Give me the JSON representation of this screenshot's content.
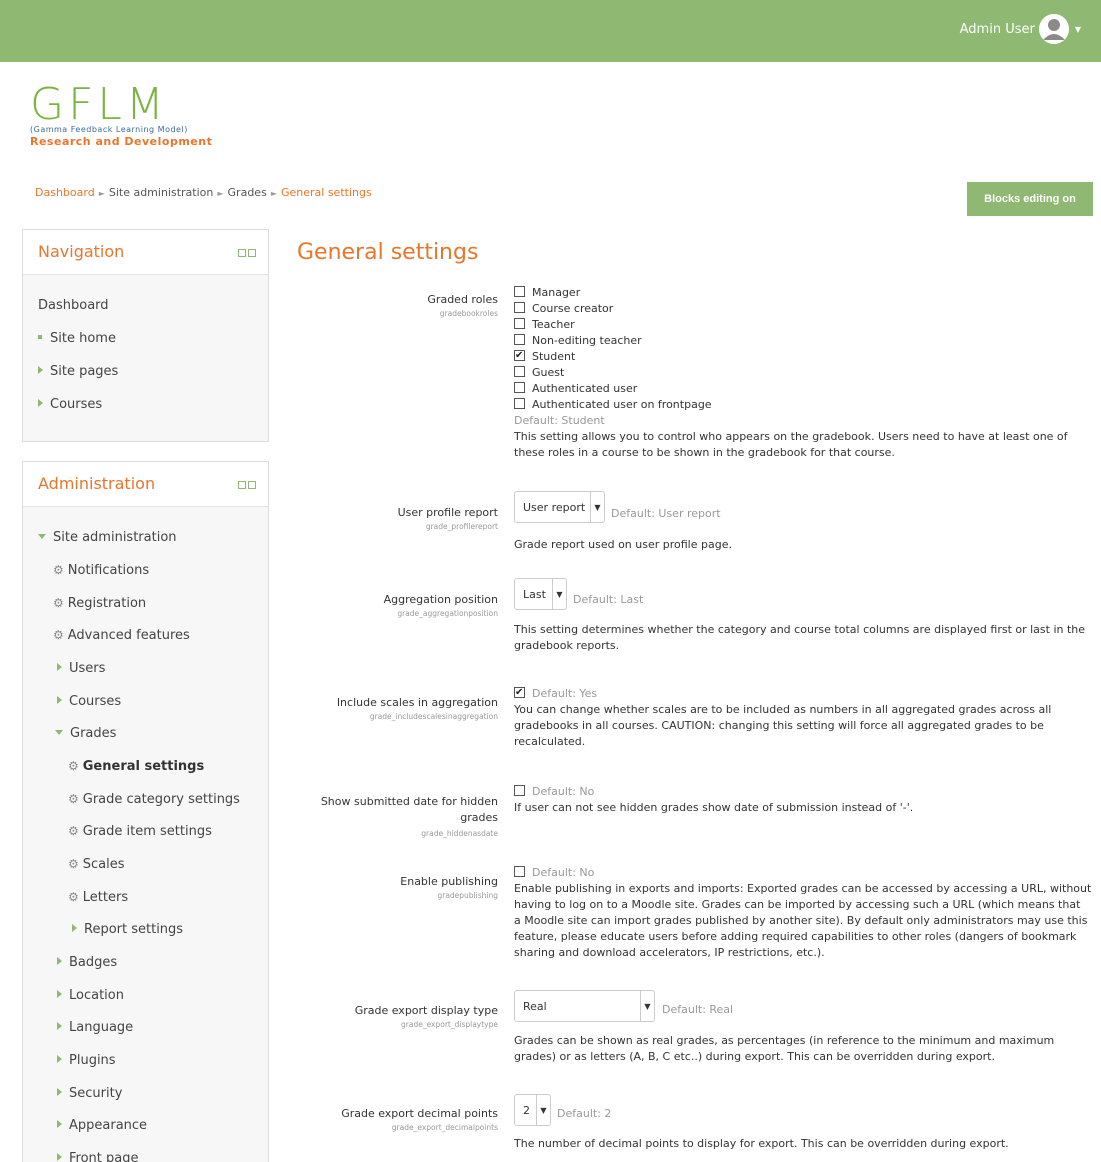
{
  "user": {
    "name": "Admin User"
  },
  "logo": {
    "main": "GFLM",
    "sub1": "(Gamma Feedback Learning Model)",
    "sub2": "Research and Development"
  },
  "breadcrumb": [
    "Dashboard",
    "Site administration",
    "Grades",
    "General settings"
  ],
  "blocks_button": "Blocks editing on",
  "navigation": {
    "title": "Navigation",
    "items": [
      "Dashboard",
      "Site home",
      "Site pages",
      "Courses"
    ]
  },
  "administration": {
    "title": "Administration",
    "items": [
      "Site administration",
      "Notifications",
      "Registration",
      "Advanced features",
      "Users",
      "Courses",
      "Grades",
      "General settings",
      "Grade category settings",
      "Grade item settings",
      "Scales",
      "Letters",
      "Report settings",
      "Badges",
      "Location",
      "Language",
      "Plugins",
      "Security",
      "Appearance",
      "Front page"
    ]
  },
  "page_title": "General settings",
  "settings": {
    "graded_roles": {
      "label": "Graded roles",
      "key": "gradebookroles",
      "options": [
        "Manager",
        "Course creator",
        "Teacher",
        "Non-editing teacher",
        "Student",
        "Guest",
        "Authenticated user",
        "Authenticated user on frontpage"
      ],
      "default": "Default: Student",
      "desc1": "This setting allows you to control who appears on the gradebook. Users need to have at least one of",
      "desc2": "these roles in a course to be shown in the gradebook for that course."
    },
    "profile_report": {
      "label": "User profile report",
      "key": "grade_profilereport",
      "value": "User report",
      "default": "Default: User report",
      "desc": "Grade report used on user profile page."
    },
    "aggregation_position": {
      "label": "Aggregation position",
      "key": "grade_aggregationposition",
      "value": "Last",
      "default": "Default: Last",
      "desc1": "This setting determines whether the category and course total columns are displayed first or last in the",
      "desc2": "gradebook reports."
    },
    "include_scales": {
      "label": "Include scales in aggregation",
      "key": "grade_includescalesinaggregation",
      "default": "Default: Yes",
      "desc1": "You can change whether scales are to be included as numbers in all aggregated grades across all",
      "desc2": "gradebooks in all courses. CAUTION: changing this setting will force all aggregated grades to be",
      "desc3": "recalculated."
    },
    "hidden_date": {
      "label1": "Show submitted date for hidden",
      "label2": "grades",
      "key": "grade_hiddenasdate",
      "default": "Default: No",
      "desc": "If user can not see hidden grades show date of submission instead of '-'."
    },
    "publishing": {
      "label": "Enable publishing",
      "key": "gradepublishing",
      "default": "Default: No",
      "desc1": "Enable publishing in exports and imports: Exported grades can be accessed by accessing a URL, without",
      "desc2": "having to log on to a Moodle site. Grades can be imported by accessing such a URL (which means that",
      "desc3": "a Moodle site can import grades published by another site). By default only administrators may use this",
      "desc4": "feature, please educate users before adding required capabilities to other roles (dangers of bookmark",
      "desc5": "sharing and download accelerators, IP restrictions, etc.)."
    },
    "export_display": {
      "label": "Grade export display type",
      "key": "grade_export_displaytype",
      "value": "Real",
      "default": "Default: Real",
      "desc1": "Grades can be shown as real grades, as percentages (in reference to the minimum and maximum",
      "desc2": "grades) or as letters (A, B, C etc..) during export. This can be overridden during export."
    },
    "export_decimal": {
      "label": "Grade export decimal points",
      "key": "grade_export_decimalpoints",
      "value": "2",
      "default": "Default: 2",
      "desc": "The number of decimal points to display for export. This can be overridden during export."
    }
  }
}
